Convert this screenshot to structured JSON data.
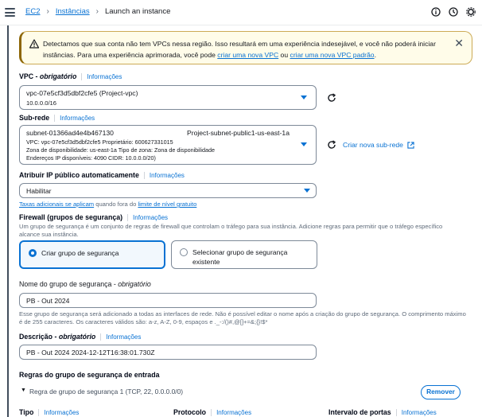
{
  "breadcrumb": {
    "items": [
      "EC2",
      "Instâncias"
    ],
    "current": "Launch an instance"
  },
  "warning": {
    "text_before": "Detectamos que sua conta não tem VPCs nessa região. Isso resultará em uma experiência indesejável, e você não poderá iniciar instâncias. Para uma experiência aprimorada, você pode ",
    "link1": "criar uma nova VPC",
    "text_mid": " ou ",
    "link2": "criar uma nova VPC padrão",
    "text_after": "."
  },
  "vpc": {
    "label": "VPC - ",
    "label_req": "obrigatório",
    "info": "Informações",
    "value": "vpc-07e5cf3d5dbf2cfe5 (Project-vpc)",
    "cidr": "10.0.0.0/16"
  },
  "subnet": {
    "label": "Sub-rede",
    "info": "Informações",
    "id": "subnet-01366ad4e4b467130",
    "name": "Project-subnet-public1-us-east-1a",
    "line1": "VPC: vpc-07e5cf3d5dbf2cfe5    Proprietário: 600627331015",
    "line2": "Zona de disponibilidade: us-east-1a    Tipo de zona: Zona de disponibilidade",
    "line3": "Endereços IP disponíveis: 4090    CIDR: 10.0.0.0/20)",
    "create_link": "Criar nova sub-rede"
  },
  "public_ip": {
    "label": "Atribuir IP público automaticamente",
    "info": "Informações",
    "value": "Habilitar",
    "note_link1": "Taxas adicionais se aplicam",
    "note_mid": " quando fora do ",
    "note_link2": "limite de nível gratuito"
  },
  "firewall": {
    "label": "Firewall (grupos de segurança)",
    "info": "Informações",
    "desc": "Um grupo de segurança é um conjunto de regras de firewall que controlam o tráfego para sua instância. Adicione regras para permitir que o tráfego específico alcance sua instância.",
    "option_create": "Criar grupo de segurança",
    "option_select_1": "Selecionar grupo de segurança",
    "option_select_2": "existente"
  },
  "sg_name": {
    "label": "Nome do grupo de segurança - ",
    "label_req": "obrigatório",
    "value": "PB - Out 2024",
    "desc": "Esse grupo de segurança será adicionado a todas as interfaces de rede. Não é possível editar o nome após a criação do grupo de segurança. O comprimento máximo é de 255 caracteres. Os caracteres válidos são: a-z, A-Z, 0-9, espaços e ._-:/()#,@[]+=&;{}!$*"
  },
  "sg_desc": {
    "label": "Descrição - ",
    "label_req": "obrigatório",
    "info": "Informações",
    "value": "PB - Out 2024 2024-12-12T16:38:01.730Z"
  },
  "inbound": {
    "title": "Regras do grupo de segurança de entrada",
    "rule_label": "Regra de grupo de segurança 1 (TCP, 22, 0.0.0.0/0)",
    "remove": "Remover",
    "col_type": "Tipo",
    "col_protocol": "Protocolo",
    "col_port": "Intervalo de portas",
    "info": "Informações"
  }
}
